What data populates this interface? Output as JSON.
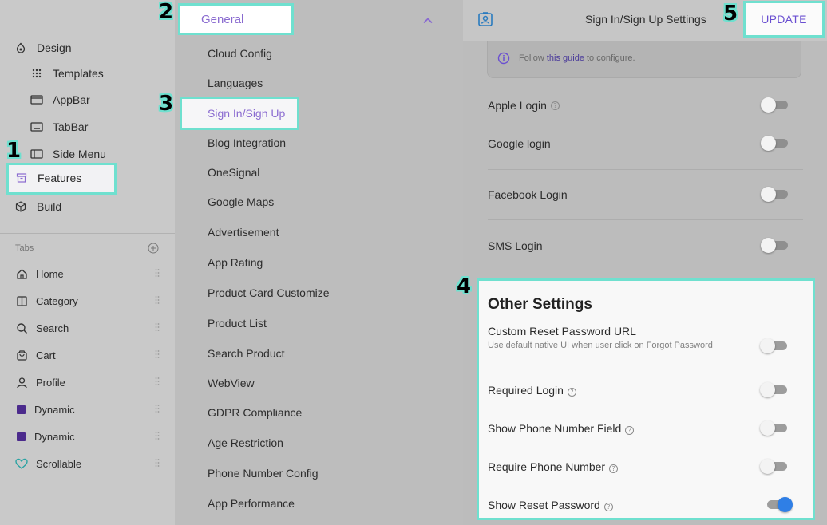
{
  "sidebar": {
    "design": "Design",
    "templates": "Templates",
    "appbar": "AppBar",
    "tabbar": "TabBar",
    "side_menu": "Side Menu",
    "features": "Features",
    "build": "Build",
    "tabs_label": "Tabs",
    "tabs": [
      "Home",
      "Category",
      "Search",
      "Cart",
      "Profile",
      "Dynamic",
      "Dynamic",
      "Scrollable"
    ]
  },
  "middle": {
    "section": "General",
    "items": [
      "Cloud Config",
      "Languages",
      "Sign In/Sign Up",
      "Blog Integration",
      "OneSignal",
      "Google Maps",
      "Advertisement",
      "App Rating",
      "Product Card Customize",
      "Product List",
      "Search Product",
      "WebView",
      "GDPR Compliance",
      "Age Restriction",
      "Phone Number Config",
      "App Performance"
    ]
  },
  "header": {
    "title": "Sign In/Sign Up Settings",
    "update": "UPDATE"
  },
  "info": {
    "prefix": "Follow ",
    "link": "this guide",
    "suffix": " to configure."
  },
  "logins": [
    {
      "label": "Apple Login",
      "help": true,
      "on": false
    },
    {
      "label": "Google login",
      "help": false,
      "on": false
    },
    {
      "label": "Facebook Login",
      "help": false,
      "on": false
    },
    {
      "label": "SMS Login",
      "help": false,
      "on": false
    }
  ],
  "other": {
    "title": "Other Settings",
    "rows": [
      {
        "label": "Custom Reset Password URL",
        "sub": "Use default native UI when user click on Forgot Password",
        "help": false,
        "on": false
      },
      {
        "label": "Required Login",
        "help": true,
        "on": false
      },
      {
        "label": "Show Phone Number Field",
        "help": true,
        "on": false
      },
      {
        "label": "Require Phone Number",
        "help": true,
        "on": false
      },
      {
        "label": "Show Reset Password",
        "help": true,
        "on": true
      }
    ]
  },
  "annotations": [
    "1",
    "2",
    "3",
    "4",
    "5"
  ],
  "colors": {
    "highlight": "#6fe0cf",
    "accent": "#8a6bd0",
    "toggle_on": "#2f7fe6"
  }
}
